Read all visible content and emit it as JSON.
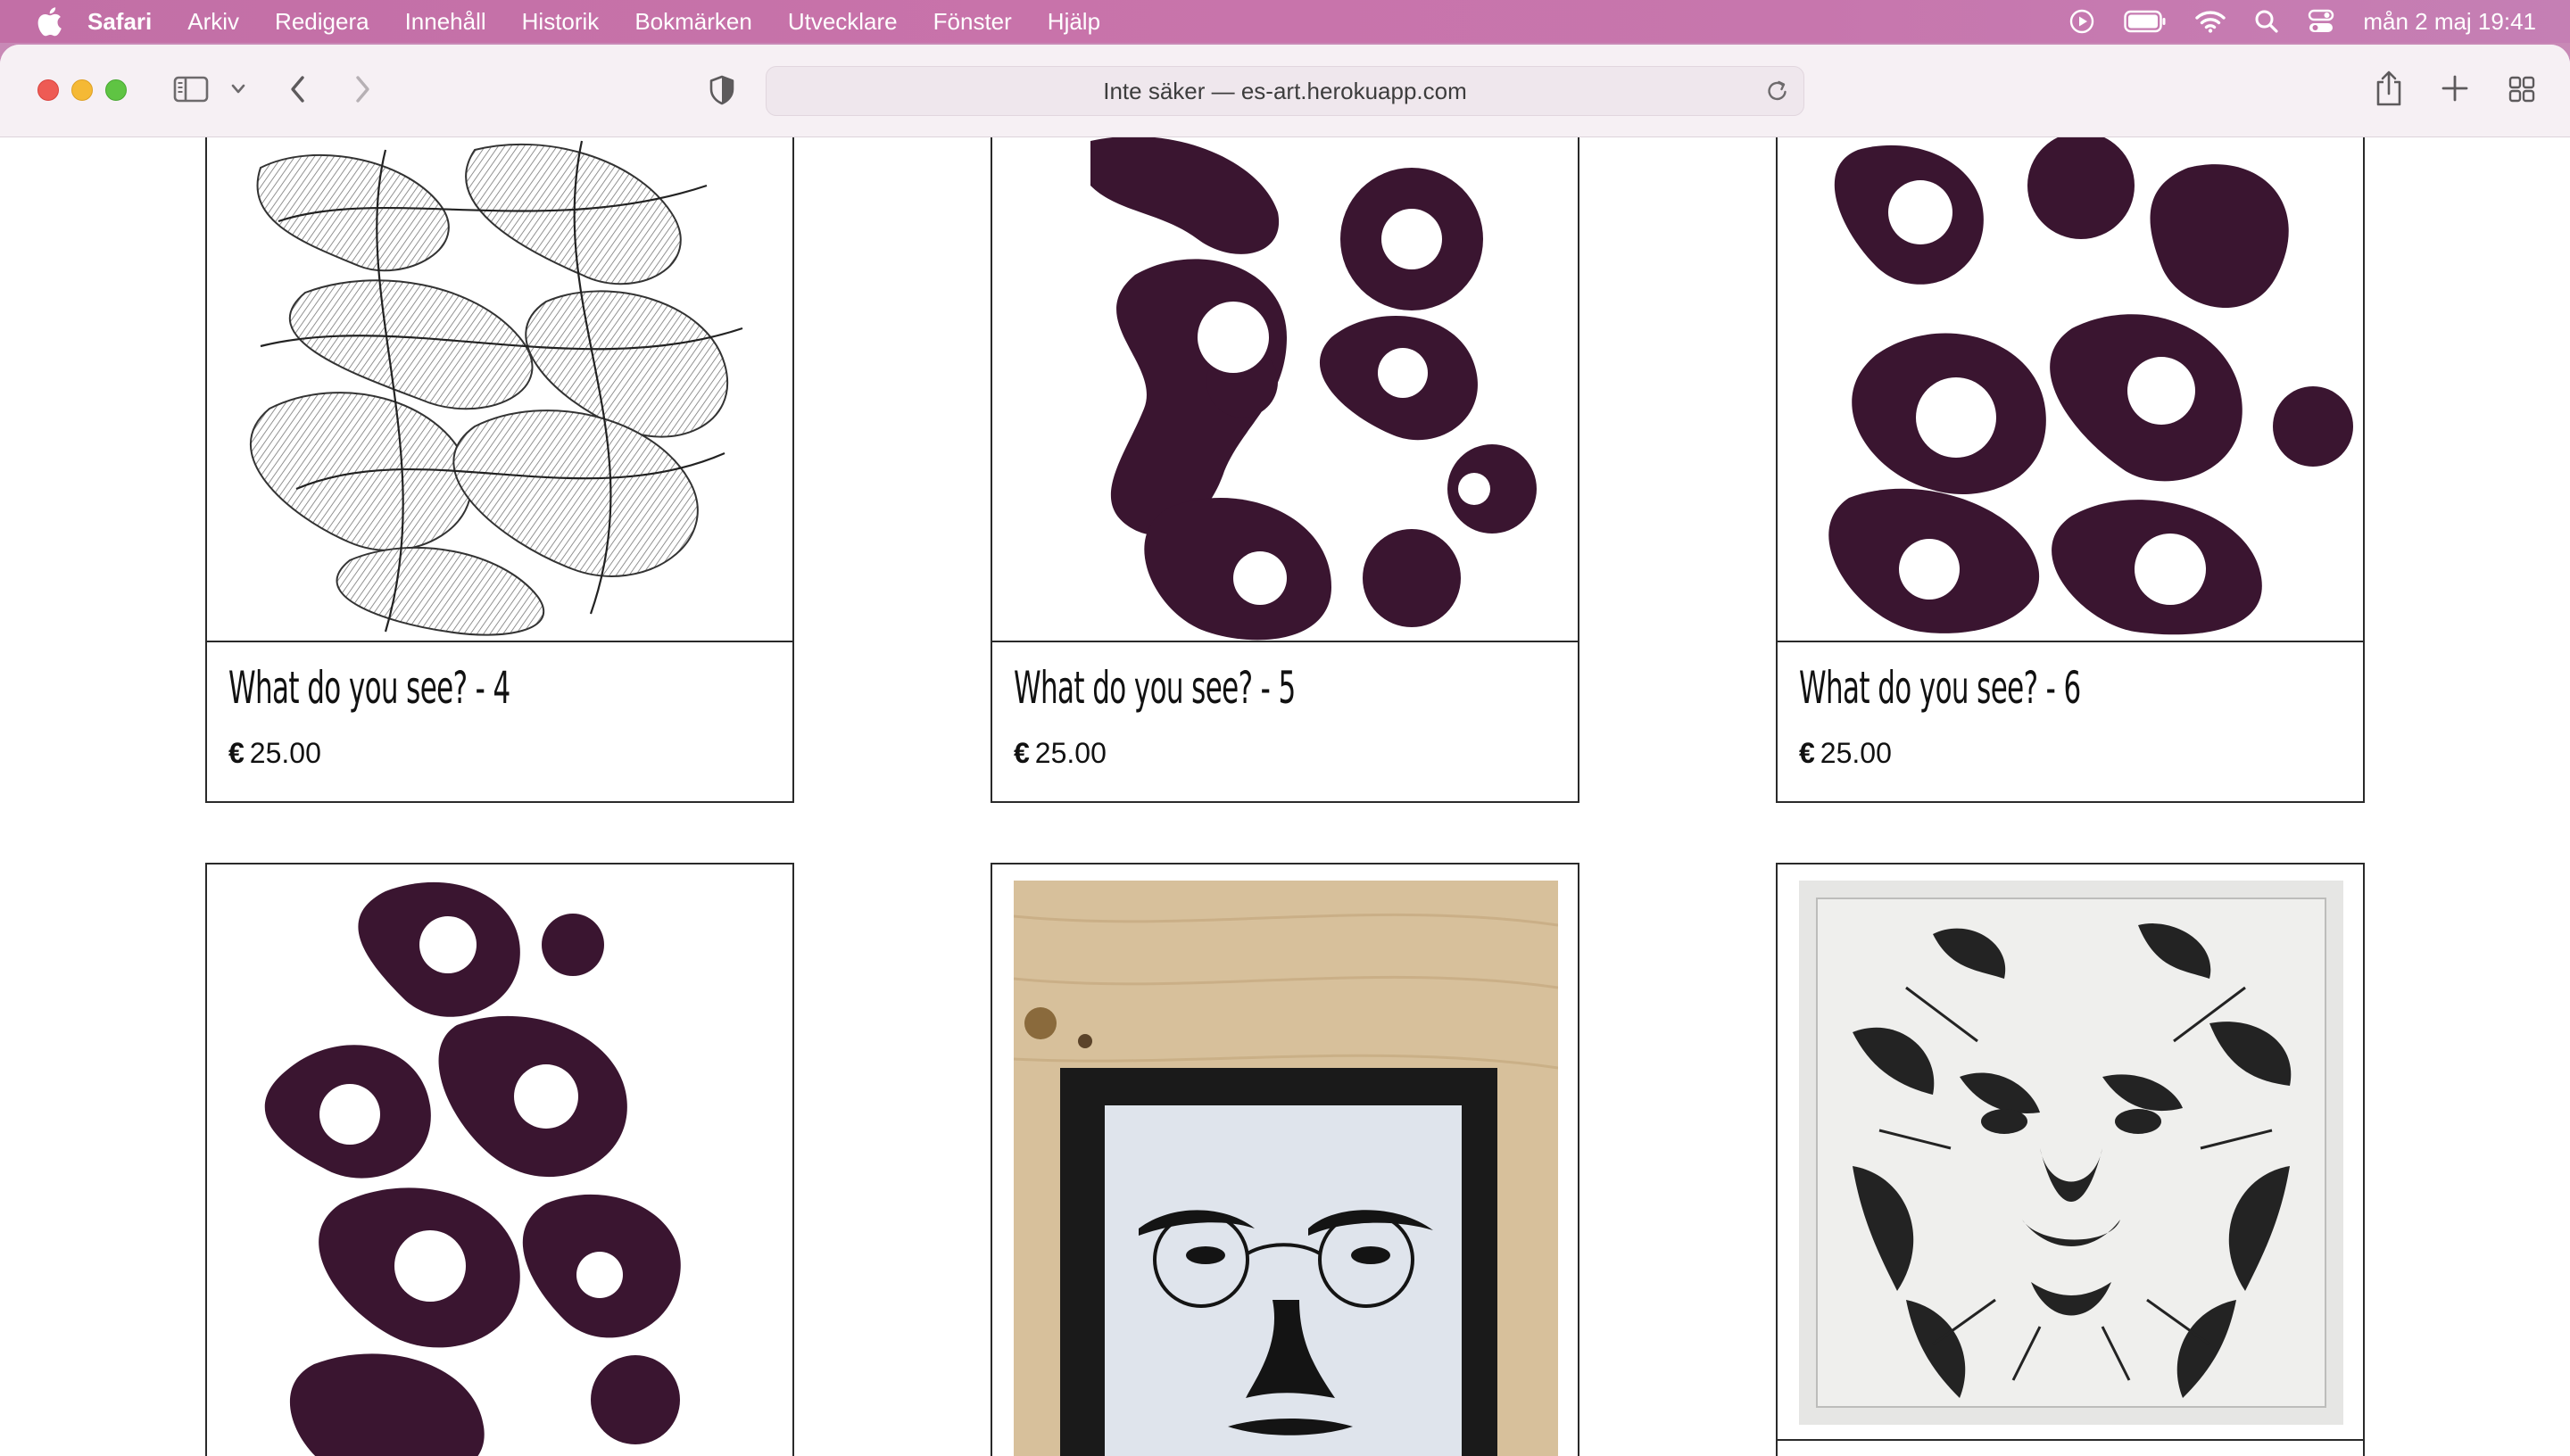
{
  "menubar": {
    "app_name": "Safari",
    "items": [
      "Arkiv",
      "Redigera",
      "Innehåll",
      "Historik",
      "Bokmärken",
      "Utvecklare",
      "Fönster",
      "Hjälp"
    ],
    "clock": "mån 2 maj  19:41"
  },
  "browser": {
    "address": "Inte säker — es-art.herokuapp.com"
  },
  "products": [
    {
      "title": "What do you see? - 4",
      "currency": "€",
      "price": "25.00"
    },
    {
      "title": "What do you see? - 5",
      "currency": "€",
      "price": "25.00"
    },
    {
      "title": "What do you see? - 6",
      "currency": "€",
      "price": "25.00"
    },
    {
      "title": "",
      "currency": "",
      "price": ""
    },
    {
      "title": "",
      "currency": "",
      "price": ""
    },
    {
      "title": "",
      "currency": "",
      "price": ""
    }
  ],
  "colors": {
    "ink": "#3a1530",
    "sketch": "#555555",
    "card_border": "#2a2a2a"
  }
}
